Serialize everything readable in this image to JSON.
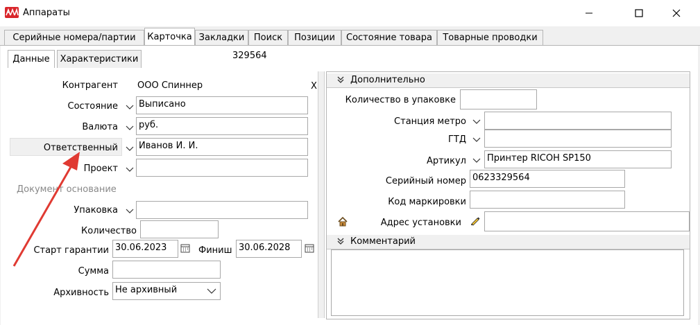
{
  "window": {
    "title": "Аппараты"
  },
  "tabs": [
    "Серийные номера/партии",
    "Карточка",
    "Закладки",
    "Поиск",
    "Позиции",
    "Состояние товара",
    "Товарные проводки"
  ],
  "subtabs": [
    "Данные",
    "Характеристики"
  ],
  "record_id": "329564",
  "left": {
    "contractor_label": "Контрагент",
    "contractor_value": "ООО Спиннер",
    "clear_label": "X",
    "state_label": "Состояние",
    "state_value": "Выписано",
    "currency_label": "Валюта",
    "currency_value": "руб.",
    "responsible_label": "Ответственный",
    "responsible_value": "Иванов И. И.",
    "project_label": "Проект",
    "project_value": "",
    "base_doc_label": "Документ основание",
    "package_label": "Упаковка",
    "package_value": "",
    "qty_label": "Количество",
    "qty_value": "",
    "warranty_start_label": "Старт гарантии",
    "warranty_start_value": "30.06.2023",
    "finish_label": "Финиш",
    "finish_value": "30.06.2028",
    "sum_label": "Сумма",
    "sum_value": "",
    "archive_label": "Архивность",
    "archive_value": "Не архивный"
  },
  "extra": {
    "header": "Дополнительно",
    "pack_qty_label": "Количество в упаковке",
    "pack_qty_value": "",
    "metro_label": "Станция метро",
    "metro_value": "",
    "gtd_label": "ГТД",
    "gtd_value": "",
    "article_label": "Артикул",
    "article_value": "Принтер RICOH SP150",
    "serial_label": "Серийный номер",
    "serial_value": "0623329564",
    "marking_label": "Код маркировки",
    "marking_value": "",
    "address_label": "Адрес установки",
    "address_value": ""
  },
  "comment": {
    "header": "Комментарий",
    "value": ""
  },
  "colors": {
    "accent_arrow": "#e03a32",
    "app_icon": "#d9262b"
  }
}
